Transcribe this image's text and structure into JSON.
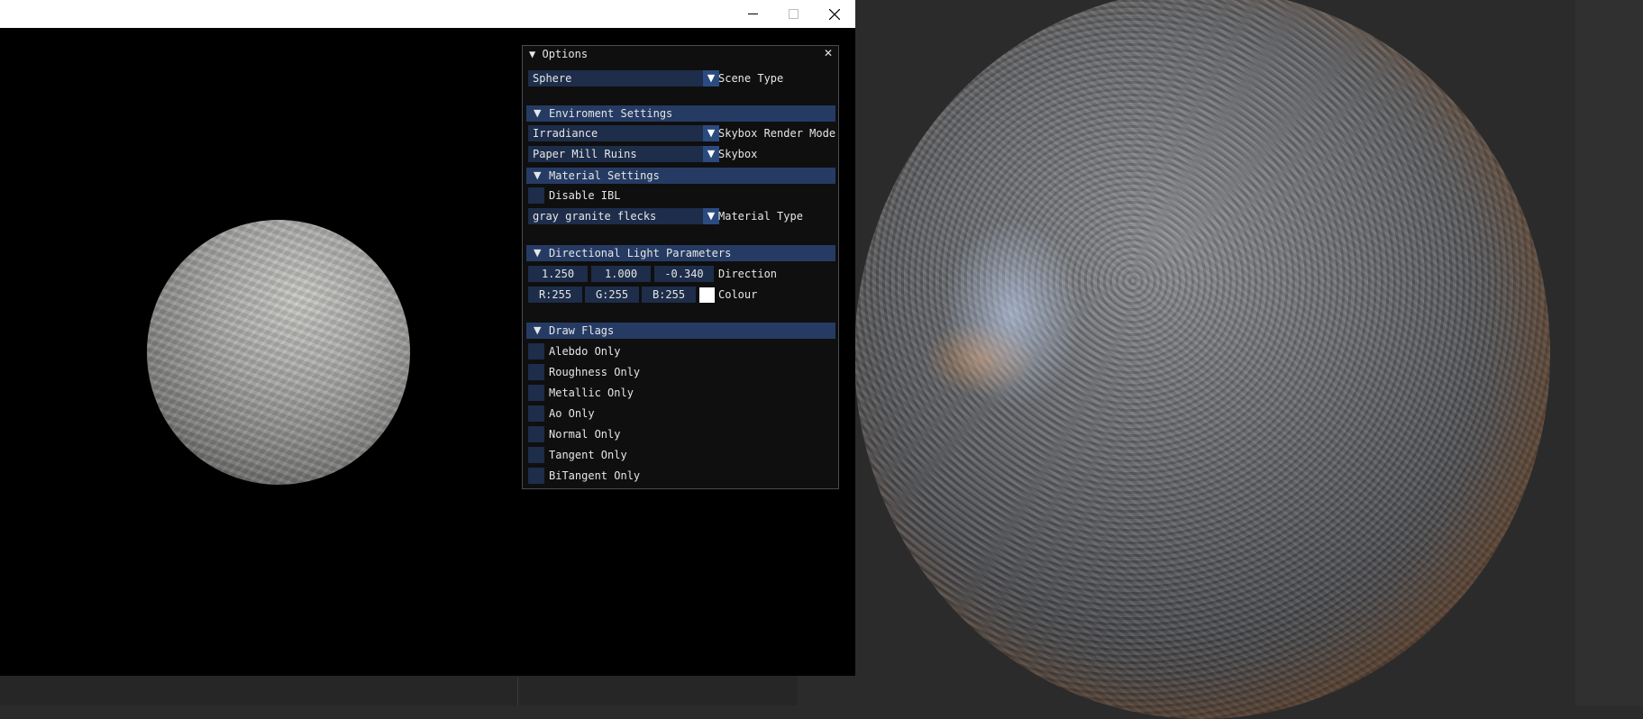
{
  "window": {
    "minimize_icon": "minimize-icon",
    "maximize_icon": "maximize-icon",
    "close_icon": "close-icon"
  },
  "options": {
    "title": "Options",
    "close_glyph": "✕",
    "scene_type": {
      "value": "Sphere",
      "label": "Scene Type"
    },
    "environment": {
      "header": "Enviroment Settings",
      "skybox_render_mode": {
        "value": "Irradiance",
        "label": "Skybox Render Mode"
      },
      "skybox": {
        "value": "Paper Mill Ruins",
        "label": "Skybox"
      }
    },
    "material": {
      "header": "Material Settings",
      "disable_ibl": {
        "label": "Disable IBL",
        "checked": false
      },
      "material_type": {
        "value": "gray granite flecks",
        "label": "Material Type"
      }
    },
    "light": {
      "header": "Directional Light Parameters",
      "direction": [
        "1.250",
        "1.000",
        "-0.340"
      ],
      "direction_label": "Direction",
      "colour": [
        "R:255",
        "G:255",
        "B:255"
      ],
      "colour_label": "Colour",
      "colour_swatch": "#ffffff"
    },
    "draw_flags": {
      "header": "Draw Flags",
      "items": [
        {
          "label": "Alebdo Only",
          "checked": false
        },
        {
          "label": "Roughness Only",
          "checked": false
        },
        {
          "label": "Metallic Only",
          "checked": false
        },
        {
          "label": "Ao Only",
          "checked": false
        },
        {
          "label": "Normal Only",
          "checked": false
        },
        {
          "label": "Tangent Only",
          "checked": false
        },
        {
          "label": "BiTangent Only",
          "checked": false
        }
      ]
    },
    "collapse_glyph": "▼",
    "combo_glyph": "▼"
  },
  "colors": {
    "frame_bg": "#1d2d4a",
    "header_bg": "#253b63",
    "button": "#2b4a80"
  }
}
